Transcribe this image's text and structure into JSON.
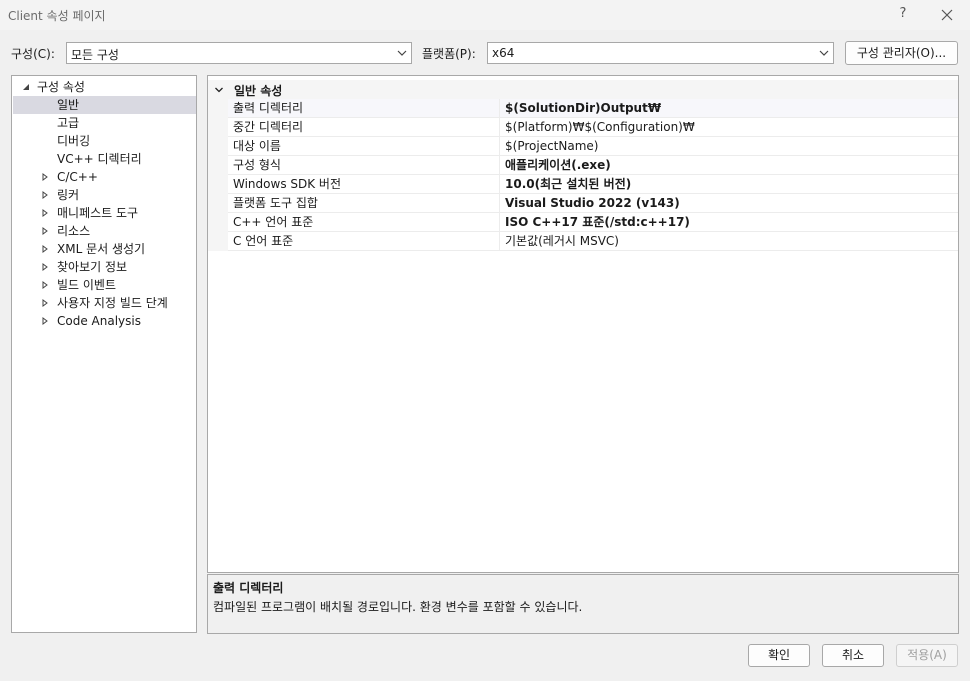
{
  "window": {
    "title": "Client 속성 페이지",
    "help_label": "?",
    "close_icon": "close-icon"
  },
  "toolbar": {
    "config_label": "구성(C):",
    "config_value": "모든 구성",
    "platform_label": "플랫폼(P):",
    "platform_value": "x64",
    "config_manager_label": "구성 관리자(O)..."
  },
  "tree": {
    "items": [
      {
        "label": "구성 속성",
        "expander": "expanded",
        "level": 0
      },
      {
        "label": "일반",
        "expander": "none",
        "level": 1,
        "selected": true
      },
      {
        "label": "고급",
        "expander": "none",
        "level": 1
      },
      {
        "label": "디버깅",
        "expander": "none",
        "level": 1
      },
      {
        "label": "VC++ 디렉터리",
        "expander": "none",
        "level": 1
      },
      {
        "label": "C/C++",
        "expander": "collapsed",
        "level": 1
      },
      {
        "label": "링커",
        "expander": "collapsed",
        "level": 1
      },
      {
        "label": "매니페스트 도구",
        "expander": "collapsed",
        "level": 1
      },
      {
        "label": "리소스",
        "expander": "collapsed",
        "level": 1
      },
      {
        "label": "XML 문서 생성기",
        "expander": "collapsed",
        "level": 1
      },
      {
        "label": "찾아보기 정보",
        "expander": "collapsed",
        "level": 1
      },
      {
        "label": "빌드 이벤트",
        "expander": "collapsed",
        "level": 1
      },
      {
        "label": "사용자 지정 빌드 단계",
        "expander": "collapsed",
        "level": 1
      },
      {
        "label": "Code Analysis",
        "expander": "collapsed",
        "level": 1
      }
    ]
  },
  "grid": {
    "category": "일반 속성",
    "rows": [
      {
        "name": "출력 디렉터리",
        "value": "$(SolutionDir)Output₩",
        "bold": true
      },
      {
        "name": "중간 디렉터리",
        "value": "$(Platform)₩$(Configuration)₩",
        "bold": false
      },
      {
        "name": "대상 이름",
        "value": "$(ProjectName)",
        "bold": false
      },
      {
        "name": "구성 형식",
        "value": "애플리케이션(.exe)",
        "bold": true
      },
      {
        "name": "Windows SDK 버전",
        "value": "10.0(최근 설치된 버전)",
        "bold": true
      },
      {
        "name": "플랫폼 도구 집합",
        "value": "Visual Studio 2022 (v143)",
        "bold": true
      },
      {
        "name": "C++ 언어 표준",
        "value": "ISO C++17 표준(/std:c++17)",
        "bold": true
      },
      {
        "name": "C 언어 표준",
        "value": "기본값(레거시 MSVC)",
        "bold": false
      }
    ]
  },
  "description": {
    "title": "출력 디렉터리",
    "text": "컴파일된 프로그램이 배치될 경로입니다. 환경 변수를 포함할 수 있습니다."
  },
  "footer": {
    "ok_label": "확인",
    "cancel_label": "취소",
    "apply_label": "적용(A)"
  },
  "colors": {
    "selection": "#d9d9e1",
    "border": "#a8a8a8",
    "background": "#f0f0f0"
  }
}
